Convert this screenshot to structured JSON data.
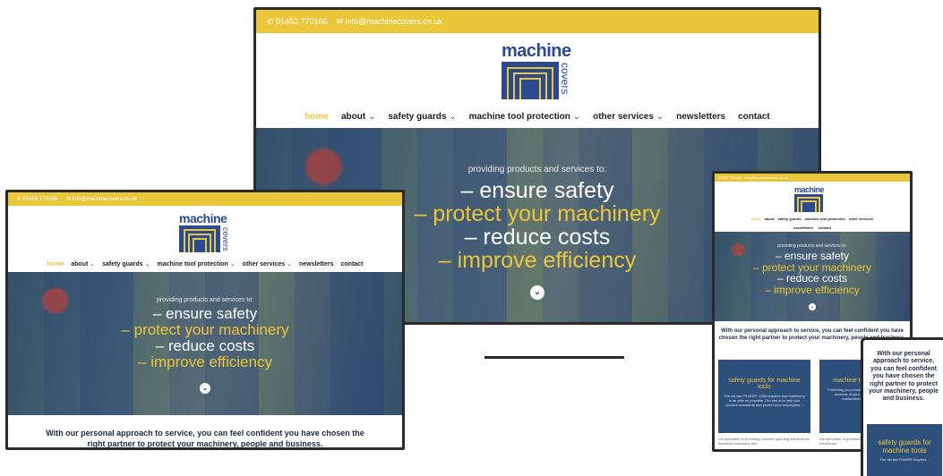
{
  "site": {
    "phone": "01452 770166",
    "email": "info@machinecovers.co.uk",
    "logo_word": "machine",
    "logo_vertical": "covers",
    "brand_yellow": "#eac63b",
    "brand_blue": "#2b4a90"
  },
  "nav": {
    "items": [
      {
        "label": "home",
        "active": true,
        "has_menu": false
      },
      {
        "label": "about",
        "active": false,
        "has_menu": true
      },
      {
        "label": "safety guards",
        "active": false,
        "has_menu": true
      },
      {
        "label": "machine tool protection",
        "active": false,
        "has_menu": true
      },
      {
        "label": "other services",
        "active": false,
        "has_menu": true
      },
      {
        "label": "newsletters",
        "active": false,
        "has_menu": false
      },
      {
        "label": "contact",
        "active": false,
        "has_menu": false
      }
    ],
    "caret": "⌄"
  },
  "hero": {
    "subtitle": "providing products and services to:",
    "lines": [
      {
        "text": "– ensure safety",
        "color": "white"
      },
      {
        "text": "– protect your machinery",
        "color": "yellow"
      },
      {
        "text": "– reduce costs",
        "color": "white"
      },
      {
        "text": "– improve efficiency",
        "color": "yellow"
      }
    ],
    "scroll_icon": "chevron-down-icon"
  },
  "intro": {
    "text": "With our personal approach to service, you can feel confident you have chosen the right partner to protect your machinery, people and business."
  },
  "cards": {
    "safety_title": "safety guards for machine tools",
    "safety_body": "The old law 'PUWER' 1998 requires that machinery is as safe as possible. Our aim is to help you achieve standards and protect your employees...",
    "safety_foot": "We specialise in providing machine guarding solutions for industrial machinery and",
    "protection_title": "machine tool protection",
    "protection_body": "Protecting your machine tools is essential to the success of your business. If machinery malfunctions it can cost you...",
    "protection_foot": "We specialise in protecting machinery at risk of breakdown"
  },
  "phone_view": {
    "intro": "With our personal approach to service, you can feel confident you have chosen the right partner to protect your machinery, people and business.",
    "card_title": "safety guards for machine tools",
    "card_body": "The old law PUWER requires..."
  }
}
